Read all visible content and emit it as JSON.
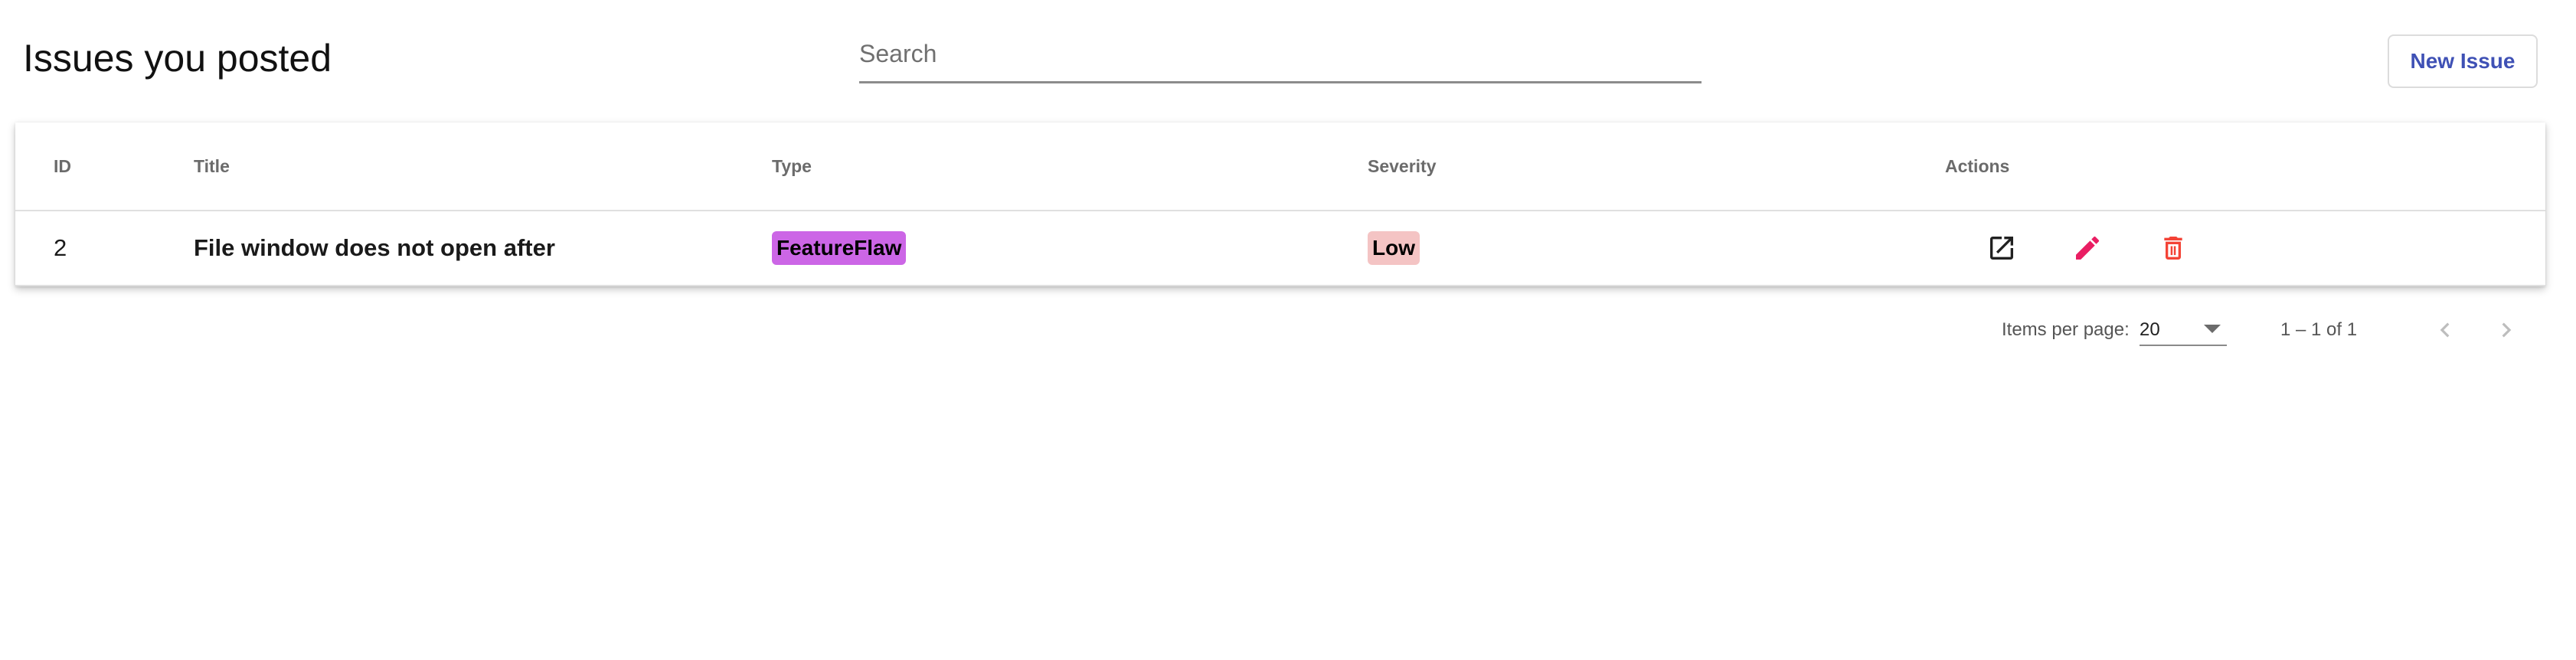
{
  "header": {
    "title": "Issues you posted",
    "search_placeholder": "Search",
    "new_issue_label": "New Issue"
  },
  "table": {
    "columns": [
      "ID",
      "Title",
      "Type",
      "Severity",
      "Actions"
    ],
    "rows": [
      {
        "id": "2",
        "title": "File window does not open after",
        "type": "FeatureFlaw",
        "severity": "Low"
      }
    ]
  },
  "colors": {
    "type_chip": "#cc66e6",
    "severity_chip": "#f4c4c4",
    "open_icon": "#212121",
    "edit_icon": "#e91e63",
    "delete_icon": "#f44336",
    "accent": "#3f51b5"
  },
  "icons": {
    "open": "open-in-new-icon",
    "edit": "pencil-icon",
    "delete": "trash-icon",
    "prev": "chevron-left-icon",
    "next": "chevron-right-icon"
  },
  "paginator": {
    "items_per_page_label": "Items per page:",
    "page_size": "20",
    "range_label": "1 – 1 of 1"
  }
}
